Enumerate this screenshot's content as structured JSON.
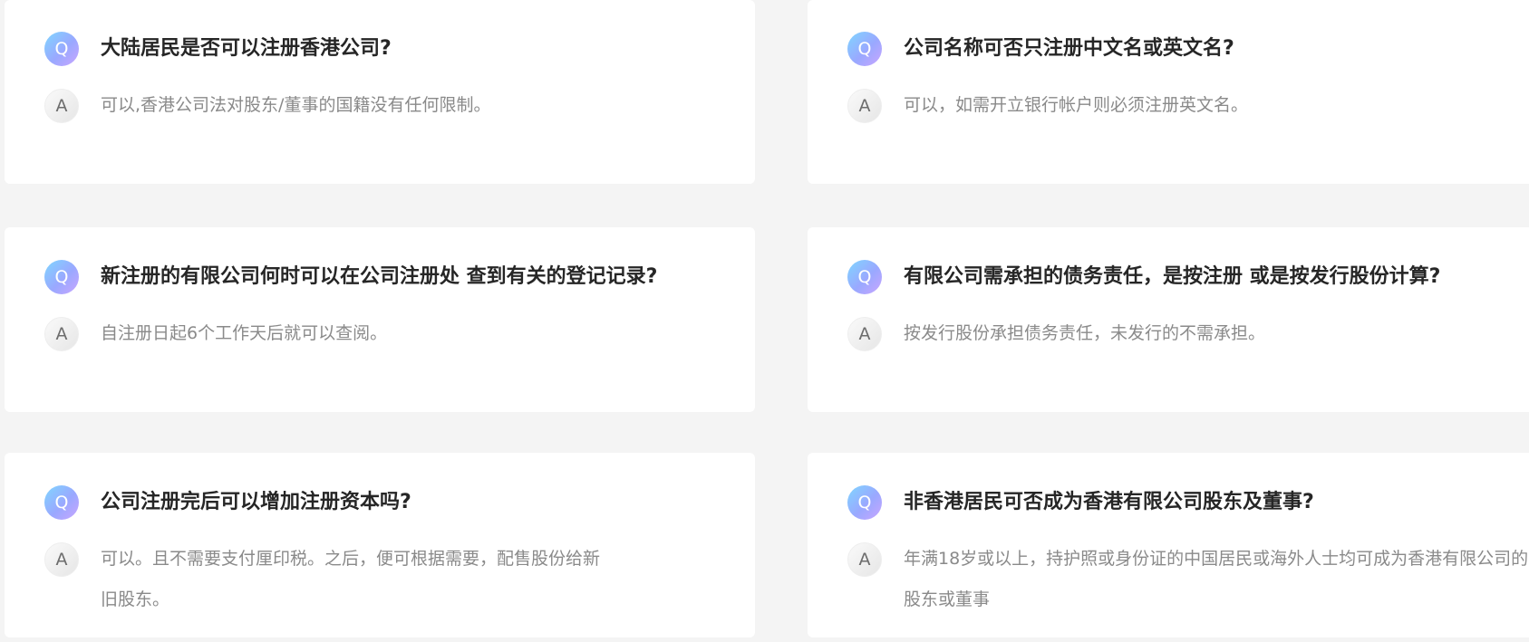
{
  "faq": [
    {
      "q_icon": "Q",
      "a_icon": "A",
      "question": "大陆居民是否可以注册香港公司?",
      "answer": "可以,香港公司法对股东/董事的国籍没有任何限制。"
    },
    {
      "q_icon": "Q",
      "a_icon": "A",
      "question": "公司名称可否只注册中文名或英文名?",
      "answer": "可以，如需开立银行帐户则必须注册英文名。"
    },
    {
      "q_icon": "Q",
      "a_icon": "A",
      "question": "新注册的有限公司何时可以在公司注册处 查到有关的登记记录?",
      "answer": "自注册日起6个工作天后就可以查阅。"
    },
    {
      "q_icon": "Q",
      "a_icon": "A",
      "question": "有限公司需承担的债务责任，是按注册 或是按发行股份计算?",
      "answer": "按发行股份承担债务责任，未发行的不需承担。"
    },
    {
      "q_icon": "Q",
      "a_icon": "A",
      "question": "公司注册完后可以增加注册资本吗?",
      "answer": "可以。且不需要支付厘印税。之后，便可根据需要，配售股份给新旧股东。"
    },
    {
      "q_icon": "Q",
      "a_icon": "A",
      "question": "非香港居民可否成为香港有限公司股东及董事?",
      "answer": "年满18岁或以上，持护照或身份证的中国居民或海外人士均可成为香港有限公司的股东或董事"
    }
  ],
  "colors": {
    "background": "#f4f4f4",
    "card": "#ffffff",
    "question_text": "#262626",
    "answer_text": "#8a8a8a",
    "q_badge_gradient": [
      "#7fd6ff",
      "#9aa8ff",
      "#c9a6ff"
    ],
    "a_badge": "#ececec"
  }
}
